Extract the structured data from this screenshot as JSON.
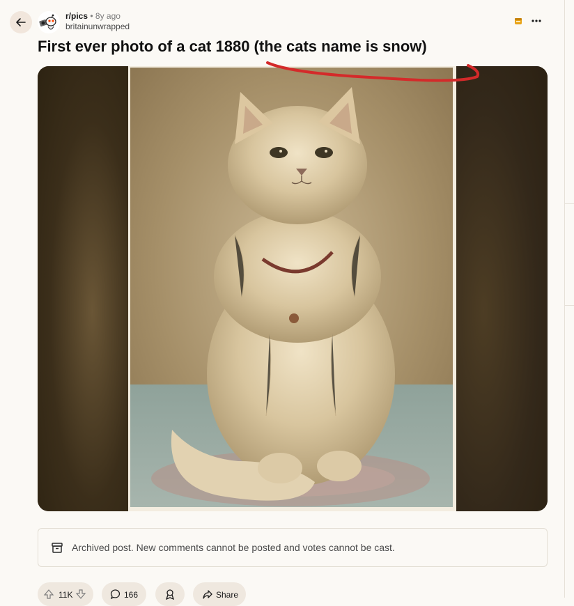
{
  "post": {
    "subreddit": "r/pics",
    "separator": "•",
    "age": "8y ago",
    "author": "britainunwrapped",
    "title": "First ever photo of a cat 1880 (the cats name is snow)"
  },
  "archive_notice": "Archived post. New comments cannot be posted and votes cannot be cast.",
  "actions": {
    "votes": "11K",
    "comments": "166",
    "share": "Share"
  },
  "colors": {
    "annotation": "#d42a2a",
    "pill_bg": "#efe8df",
    "page_bg": "#fbf9f5"
  },
  "icons": [
    "back-arrow-icon",
    "subreddit-avatar-icon",
    "award-icon",
    "more-options-icon",
    "archive-icon",
    "upvote-icon",
    "downvote-icon",
    "comment-icon",
    "award-pill-icon",
    "share-icon"
  ]
}
